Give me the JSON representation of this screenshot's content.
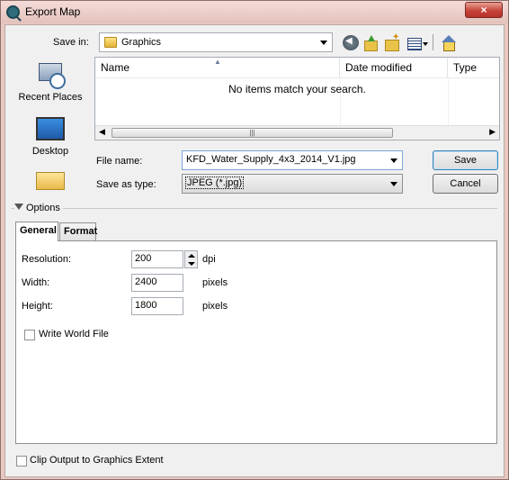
{
  "window": {
    "title": "Export Map",
    "close_glyph": "×"
  },
  "toolbar": {
    "save_in_label": "Save in:",
    "save_in_value": "Graphics"
  },
  "places": [
    {
      "label": "Recent Places"
    },
    {
      "label": "Desktop"
    },
    {
      "label": ""
    }
  ],
  "filelist": {
    "columns": [
      "Name",
      "Date modified",
      "Type"
    ],
    "empty_message": "No items match your search.",
    "scroll_thumb_grip": "|||"
  },
  "file": {
    "name_label": "File name:",
    "name_value": "KFD_Water_Supply_4x3_2014_V1.jpg",
    "type_label": "Save as type:",
    "type_value": "JPEG (*.jpg)"
  },
  "buttons": {
    "save": "Save",
    "cancel": "Cancel"
  },
  "options": {
    "toggle_label": "Options",
    "tabs": [
      "General",
      "Format"
    ],
    "resolution_label": "Resolution:",
    "resolution_value": "200",
    "resolution_unit": "dpi",
    "width_label": "Width:",
    "width_value": "2400",
    "width_unit": "pixels",
    "height_label": "Height:",
    "height_value": "1800",
    "height_unit": "pixels",
    "world_file_label": "Write World File",
    "world_file_checked": false
  },
  "footer": {
    "clip_label": "Clip Output to Graphics Extent",
    "clip_checked": false
  }
}
